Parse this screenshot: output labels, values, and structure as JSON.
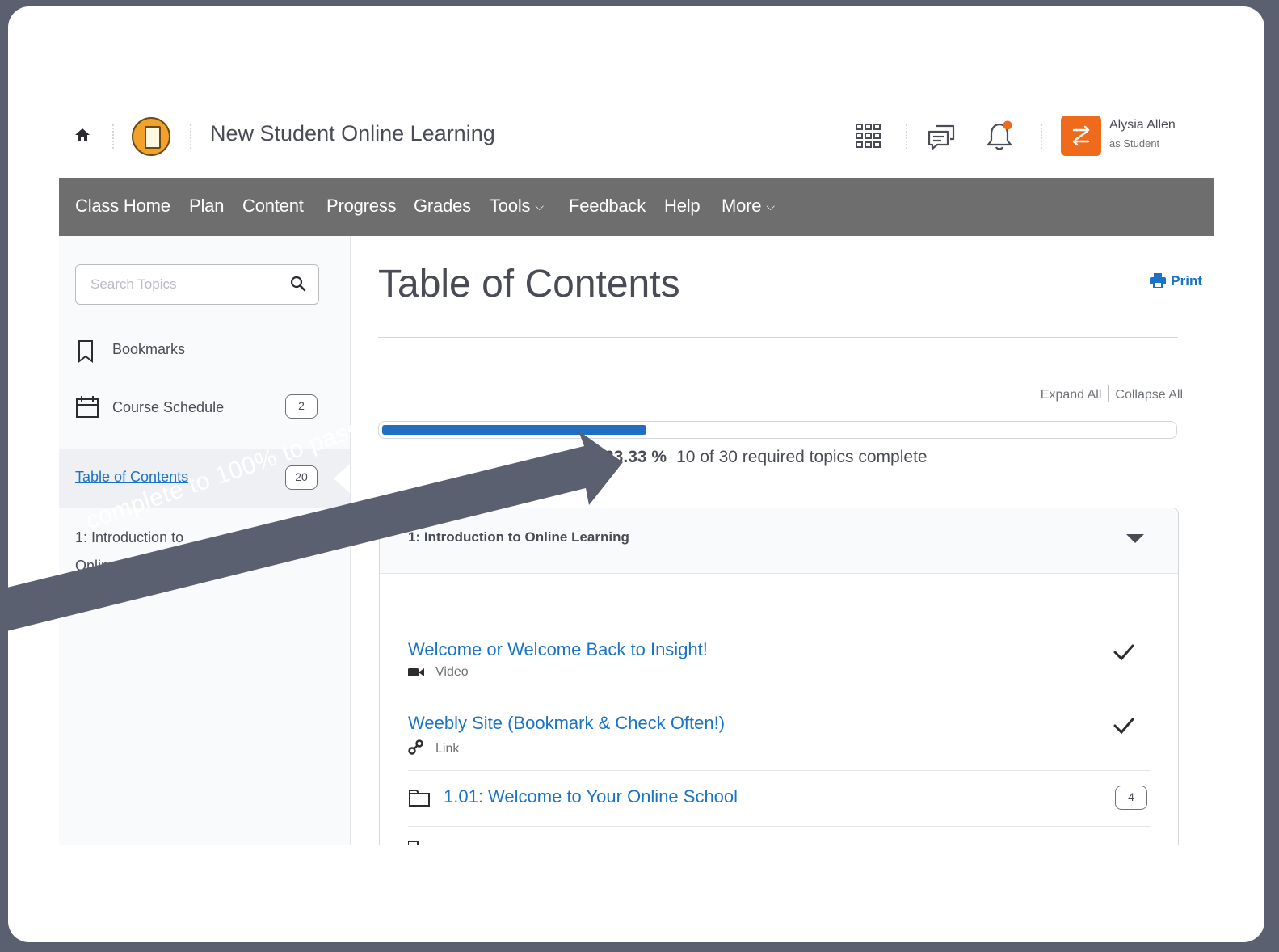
{
  "header": {
    "course_title": "New Student Online Learning",
    "user_name": "Alysia Allen",
    "user_role": "as Student",
    "notification_color": "#ef6b1b"
  },
  "nav": {
    "items": [
      "Class Home",
      "Plan",
      "Content",
      "Progress",
      "Grades",
      "Tools",
      "Feedback",
      "Help",
      "More"
    ]
  },
  "sidebar": {
    "search_placeholder": "Search Topics",
    "bookmarks": "Bookmarks",
    "course_schedule": "Course Schedule",
    "course_schedule_count": "2",
    "toc": "Table of Contents",
    "toc_count": "20",
    "module_link": "1: Introduction to Online Learning"
  },
  "main": {
    "title": "Table of Contents",
    "print": "Print",
    "expand_all": "Expand All",
    "collapse_all": "Collapse All",
    "progress_fraction": 0.3333,
    "progress_percent": "33.33 %",
    "progress_text": "10 of 30 required topics complete",
    "module_title": "1: Introduction to Online Learning",
    "topics": [
      {
        "title": "Welcome or Welcome Back to Insight!",
        "type": "Video",
        "icon": "video-icon",
        "completed": true
      },
      {
        "title": "Weebly Site (Bookmark & Check Often!)",
        "type": "Link",
        "icon": "link-icon",
        "completed": true
      }
    ],
    "folder": {
      "title": "1.01: Welcome to Your Online School",
      "count": "4"
    }
  },
  "annotation": {
    "text": "complete to 100% to pass!",
    "color": "#5b6070"
  }
}
